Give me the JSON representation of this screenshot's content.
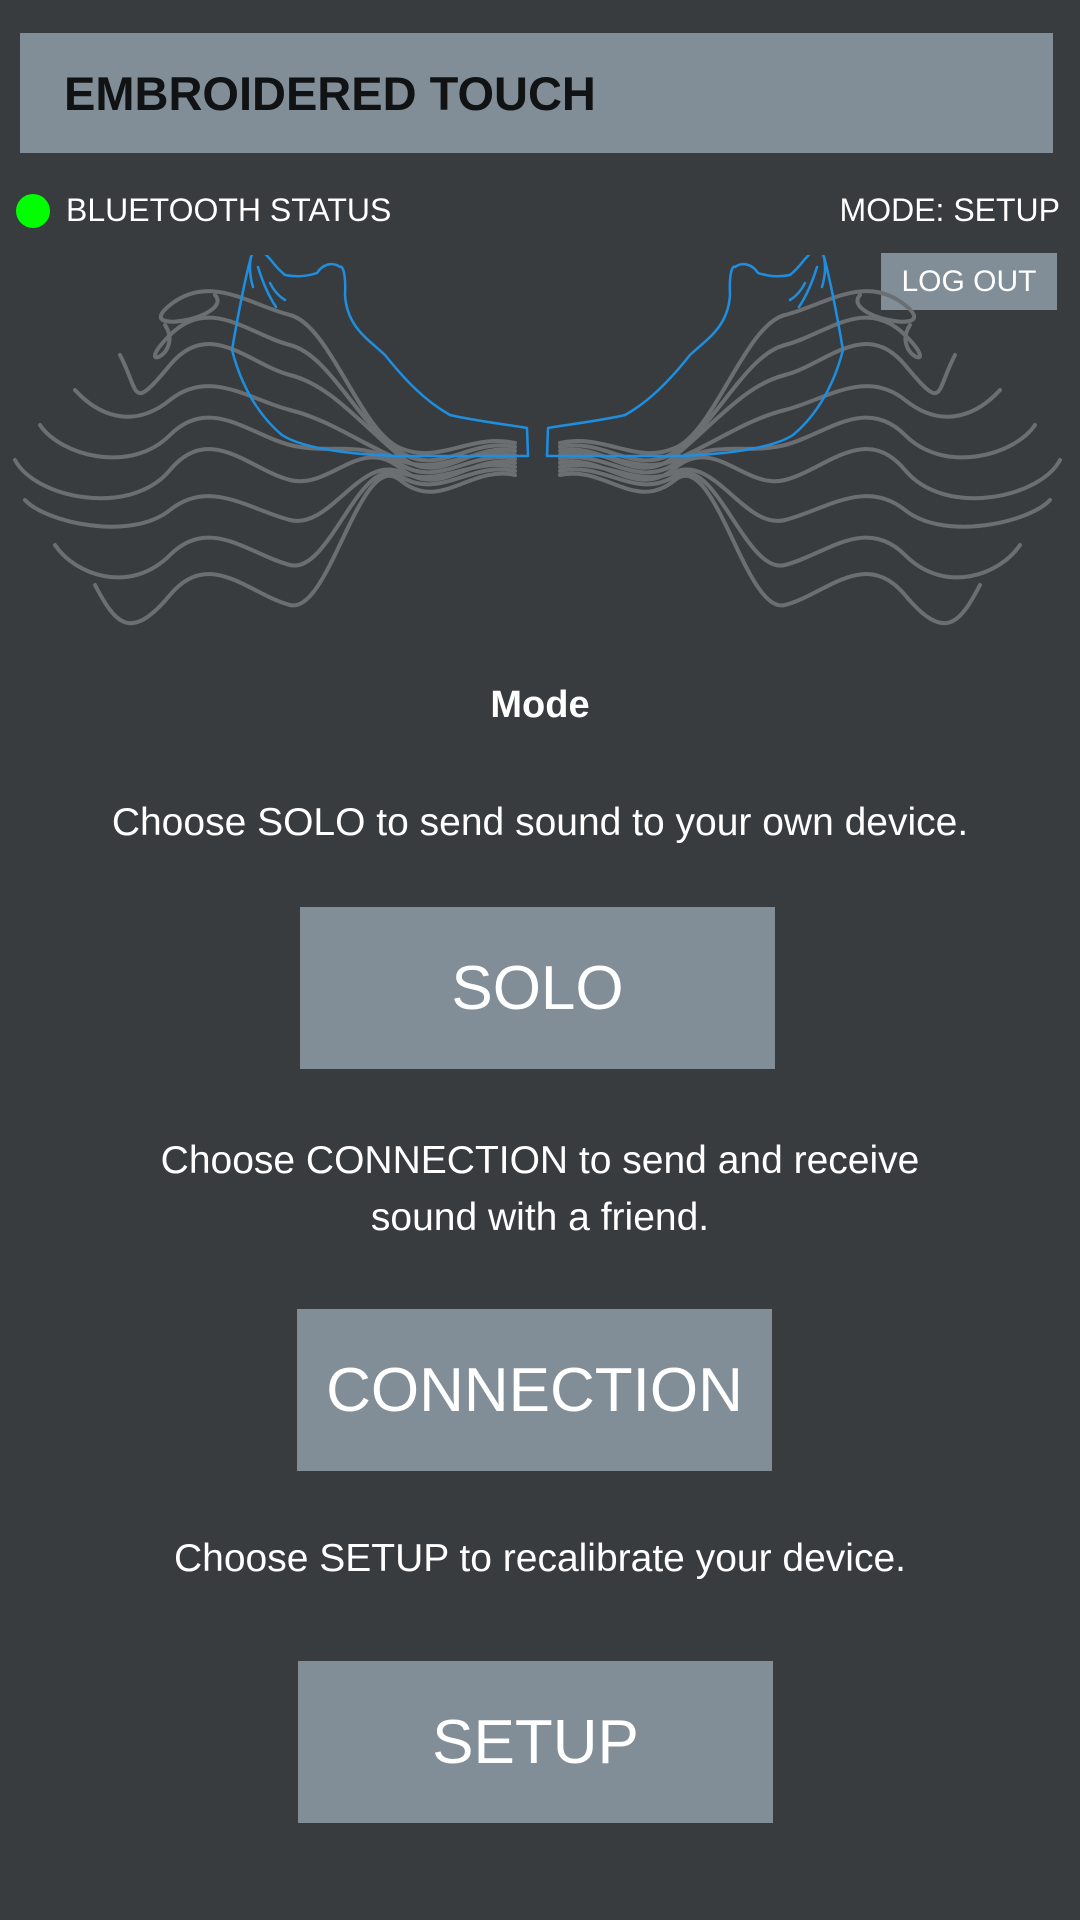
{
  "header": {
    "title": "EMBROIDERED TOUCH"
  },
  "status": {
    "bluetooth_label": "BLUETOOTH STATUS",
    "bluetooth_color": "#00ff00",
    "mode_readout": "MODE: SETUP",
    "logout_label": "LOG OUT"
  },
  "illustration": {
    "icon": "embroidered-hands-icon",
    "line_color": "#6b6f72",
    "hand_color": "#1e8fe0"
  },
  "mode_section": {
    "heading": "Mode",
    "solo_instruction": "Choose SOLO to send sound to your own device.",
    "solo_label": "SOLO",
    "connection_instruction_line1": "Choose CONNECTION to send and receive",
    "connection_instruction_line2": "sound with a friend.",
    "connection_label": "CONNECTION",
    "setup_instruction": "Choose SETUP to recalibrate your device.",
    "setup_label": "SETUP"
  },
  "colors": {
    "background": "#393c3f",
    "panel": "#818e98"
  }
}
